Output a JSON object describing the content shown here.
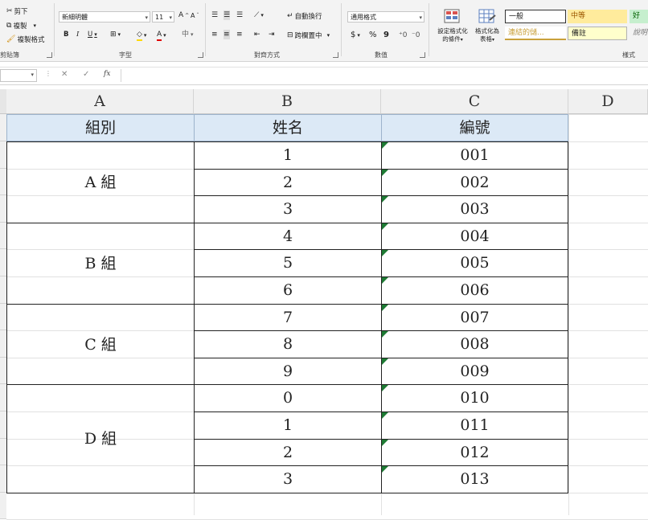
{
  "ribbon": {
    "clipboard": {
      "cut": "剪下",
      "copy": "複製",
      "format_painter": "複製格式",
      "label": "剪貼簿"
    },
    "font": {
      "name": "新細明體",
      "size": "11",
      "grow": "A",
      "shrink": "A",
      "bold": "B",
      "italic": "I",
      "underline": "U",
      "label": "字型"
    },
    "alignment": {
      "wrap": "自動換行",
      "merge": "跨欄置中",
      "label": "對齊方式"
    },
    "number": {
      "format": "通用格式",
      "currency": "$",
      "percent": "%",
      "comma": "9",
      "label": "數值"
    },
    "styles": {
      "conditional": "設定格式化的條件",
      "conditional_l1": "設定格式化",
      "conditional_l2": "的條件",
      "table_l1": "格式化為",
      "table_l2": "表格",
      "normal": "一般",
      "neutral": "中等",
      "good": "好",
      "linked": "連結的儲...",
      "note": "備註",
      "explain": "說明",
      "label": "樣式"
    }
  },
  "formula_bar": {
    "fx": "fx",
    "cancel": "✕",
    "enter": "✓",
    "content": ""
  },
  "columns": [
    "A",
    "B",
    "C",
    "D"
  ],
  "table": {
    "headers": [
      "組別",
      "姓名",
      "編號"
    ],
    "groups": [
      {
        "name": "A 組",
        "rows": [
          [
            "1",
            "001"
          ],
          [
            "2",
            "002"
          ],
          [
            "3",
            "003"
          ]
        ]
      },
      {
        "name": "B 組",
        "rows": [
          [
            "4",
            "004"
          ],
          [
            "5",
            "005"
          ],
          [
            "6",
            "006"
          ]
        ]
      },
      {
        "name": "C 組",
        "rows": [
          [
            "7",
            "007"
          ],
          [
            "8",
            "008"
          ],
          [
            "9",
            "009"
          ]
        ]
      },
      {
        "name": "D 組",
        "rows": [
          [
            "0",
            "010"
          ],
          [
            "1",
            "011"
          ],
          [
            "2",
            "012"
          ],
          [
            "3",
            "013"
          ]
        ]
      }
    ]
  },
  "colors": {
    "header_fill": "#dce9f6",
    "error_triangle": "#1e7b34",
    "grid": "#e1e1e1"
  }
}
